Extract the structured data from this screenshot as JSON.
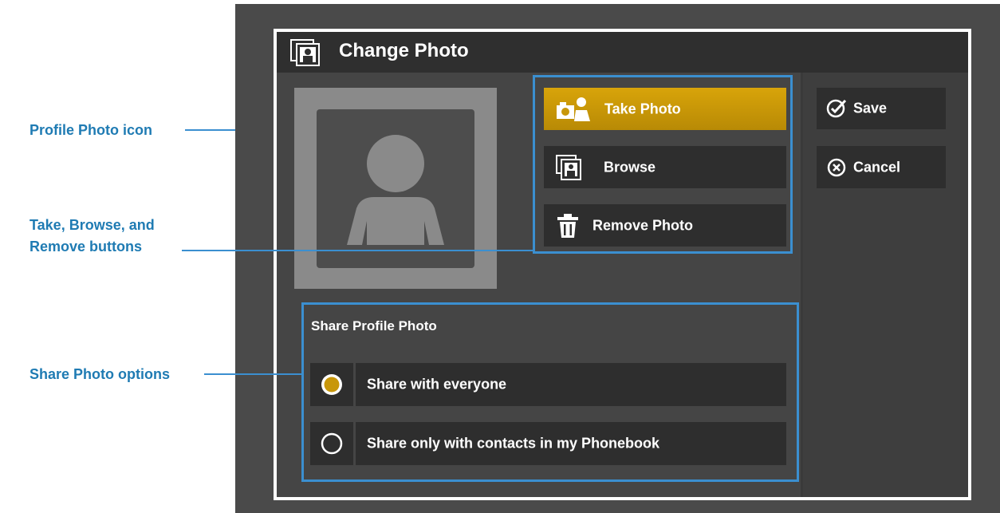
{
  "callouts": {
    "profile_photo_icon": "Profile Photo icon",
    "take_browse_remove_line1": "Take, Browse, and",
    "take_browse_remove_line2": "Remove buttons",
    "share_photo_options": "Share Photo options"
  },
  "dialog": {
    "title": "Change Photo",
    "title_icon": "photo-album-icon"
  },
  "actions": {
    "take_photo": "Take Photo",
    "browse": "Browse",
    "remove_photo": "Remove Photo"
  },
  "side_buttons": {
    "save": "Save",
    "cancel": "Cancel"
  },
  "share": {
    "title": "Share Profile Photo",
    "options": [
      {
        "label": "Share with everyone",
        "selected": true
      },
      {
        "label": "Share only with contacts in my Phonebook",
        "selected": false
      }
    ]
  },
  "colors": {
    "accent": "#c8970a",
    "callout": "#1f7bb3",
    "highlight": "#3b8fd0"
  }
}
